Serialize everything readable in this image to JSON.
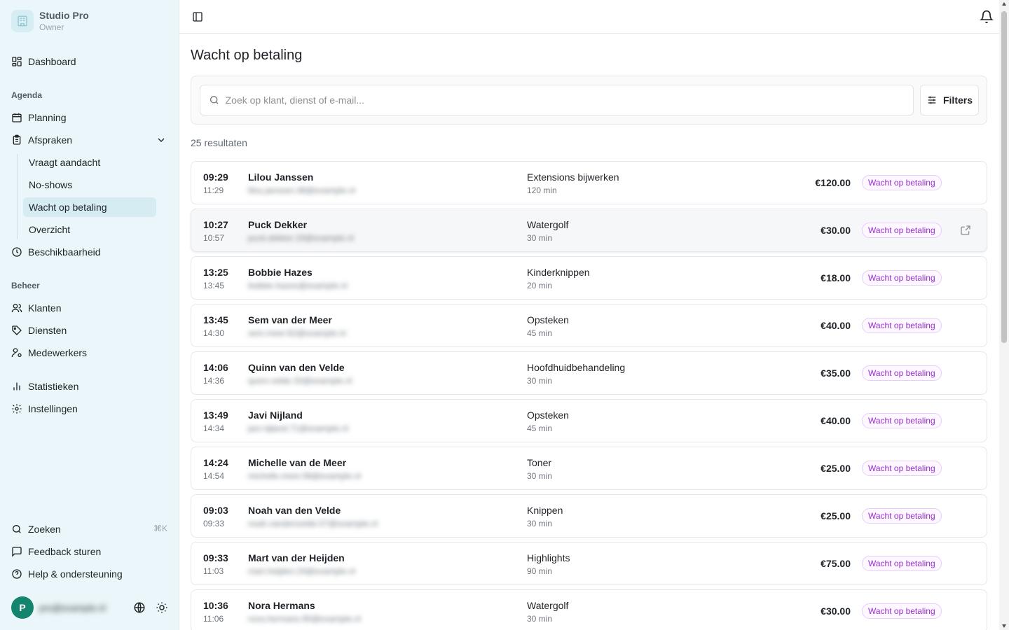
{
  "sidebar": {
    "brand": {
      "name": "Studio Pro",
      "role": "Owner"
    },
    "dashboard": "Dashboard",
    "section_agenda": "Agenda",
    "planning": "Planning",
    "afspraken": "Afspraken",
    "sub_items": [
      "Vraagt aandacht",
      "No-shows",
      "Wacht op betaling",
      "Overzicht"
    ],
    "active_sub": "Wacht op betaling",
    "beschikbaarheid": "Beschikbaarheid",
    "section_beheer": "Beheer",
    "klanten": "Klanten",
    "diensten": "Diensten",
    "medewerkers": "Medewerkers",
    "statistieken": "Statistieken",
    "instellingen": "Instellingen",
    "zoeken": "Zoeken",
    "zoeken_shortcut": "⌘K",
    "feedback": "Feedback sturen",
    "help": "Help & ondersteuning",
    "user": {
      "initial": "P",
      "email": "pro@example.nl"
    }
  },
  "main": {
    "title": "Wacht op betaling",
    "search_placeholder": "Zoek op klant, dienst of e-mail...",
    "filters_label": "Filters",
    "results_text": "25 resultaten"
  },
  "appointments": [
    {
      "start": "09:29",
      "end": "11:29",
      "name": "Lilou Janssen",
      "email": "lilou.janssen.48@example.nl",
      "service": "Extensions bijwerken",
      "duration": "120 min",
      "price": "€120.00",
      "status": "Wacht op betaling"
    },
    {
      "start": "10:27",
      "end": "10:57",
      "name": "Puck Dekker",
      "email": "puck.dekker.19@example.nl",
      "service": "Watergolf",
      "duration": "30 min",
      "price": "€30.00",
      "status": "Wacht op betaling"
    },
    {
      "start": "13:25",
      "end": "13:45",
      "name": "Bobbie Hazes",
      "email": "bobbie.hazes@example.nl",
      "service": "Kinderknippen",
      "duration": "20 min",
      "price": "€18.00",
      "status": "Wacht op betaling"
    },
    {
      "start": "13:45",
      "end": "14:30",
      "name": "Sem van der Meer",
      "email": "sem.meer.62@example.nl",
      "service": "Opsteken",
      "duration": "45 min",
      "price": "€40.00",
      "status": "Wacht op betaling"
    },
    {
      "start": "14:06",
      "end": "14:36",
      "name": "Quinn van den Velde",
      "email": "quinn.velde.33@example.nl",
      "service": "Hoofdhuidbehandeling",
      "duration": "30 min",
      "price": "€35.00",
      "status": "Wacht op betaling"
    },
    {
      "start": "13:49",
      "end": "14:34",
      "name": "Javi Nijland",
      "email": "javi.nijland.71@example.nl",
      "service": "Opsteken",
      "duration": "45 min",
      "price": "€40.00",
      "status": "Wacht op betaling"
    },
    {
      "start": "14:24",
      "end": "14:54",
      "name": "Michelle van de Meer",
      "email": "michelle.meer.08@example.nl",
      "service": "Toner",
      "duration": "30 min",
      "price": "€25.00",
      "status": "Wacht op betaling"
    },
    {
      "start": "09:03",
      "end": "09:33",
      "name": "Noah van den Velde",
      "email": "noah.vandenvelde.57@example.nl",
      "service": "Knippen",
      "duration": "30 min",
      "price": "€25.00",
      "status": "Wacht op betaling"
    },
    {
      "start": "09:33",
      "end": "11:03",
      "name": "Mart van der Heijden",
      "email": "mart.heijden.24@example.nl",
      "service": "Highlights",
      "duration": "90 min",
      "price": "€75.00",
      "status": "Wacht op betaling"
    },
    {
      "start": "10:36",
      "end": "11:06",
      "name": "Nora Hermans",
      "email": "nora.hermans.90@example.nl",
      "service": "Watergolf",
      "duration": "30 min",
      "price": "€30.00",
      "status": "Wacht op betaling"
    }
  ],
  "colors": {
    "sidebar_bg": "#eaf6f9",
    "active_bg": "#d5ecf2",
    "badge_text": "#9b2fd1",
    "badge_border": "#e7cdfb",
    "avatar_bg": "#13846e"
  }
}
